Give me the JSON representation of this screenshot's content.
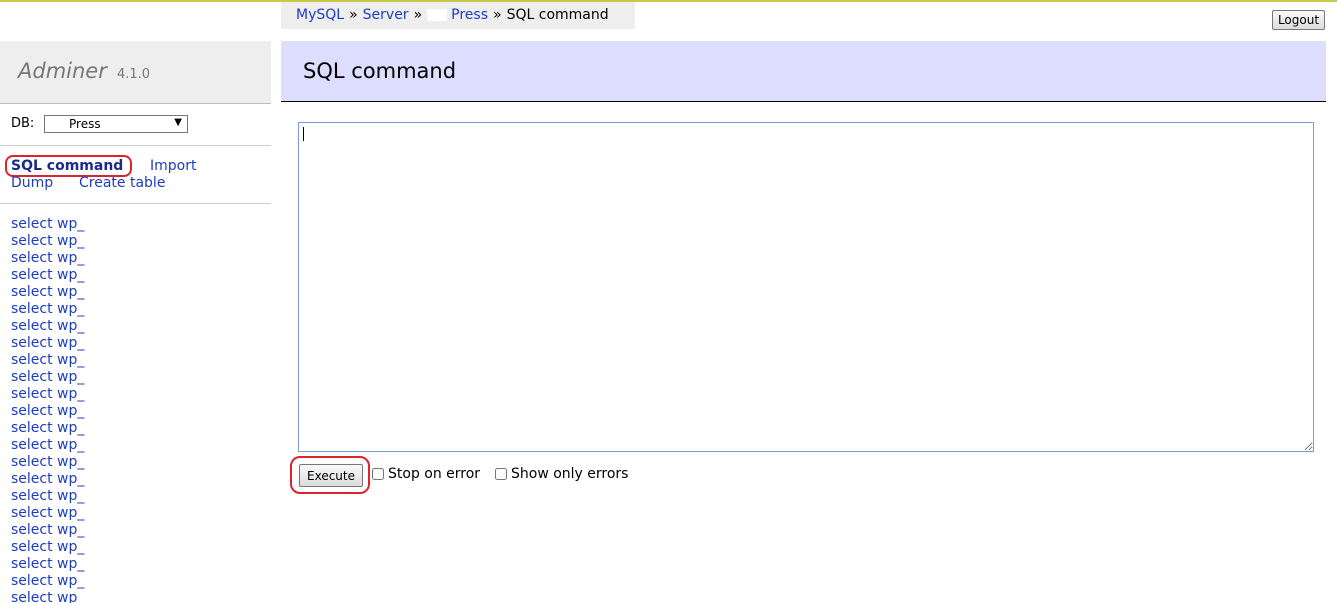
{
  "breadcrumb": {
    "mysql": "MySQL",
    "sep1": "»",
    "server": "Server",
    "sep2": "»",
    "db": "Press",
    "sep3": "»",
    "current": "SQL command"
  },
  "header": {
    "logout_label": "Logout"
  },
  "sidebar": {
    "app_name": "Adminer",
    "version": "4.1.0",
    "db_label": "DB:",
    "db_selected": "Press",
    "links": {
      "sql_command": "SQL command",
      "import": "Import",
      "dump": "Dump",
      "create_table": "Create table"
    },
    "tables": [
      "select wp_",
      "select wp_",
      "select wp_",
      "select wp_",
      "select wp_",
      "select wp_",
      "select wp_",
      "select wp_",
      "select wp_",
      "select wp_",
      "select wp_",
      "select wp_",
      "select wp_",
      "select wp_",
      "select wp_",
      "select wp_",
      "select wp_",
      "select wp_",
      "select wp_",
      "select wp_",
      "select wp_",
      "select wp_",
      "select wp_"
    ]
  },
  "main": {
    "title": "SQL command",
    "query": "",
    "execute_label": "Execute",
    "stop_on_error_label": "Stop on error",
    "show_only_errors_label": "Show only errors"
  },
  "colors": {
    "link": "#1d3dbf",
    "heading_bg": "#ddddff",
    "highlight_ring": "#d9262c"
  }
}
